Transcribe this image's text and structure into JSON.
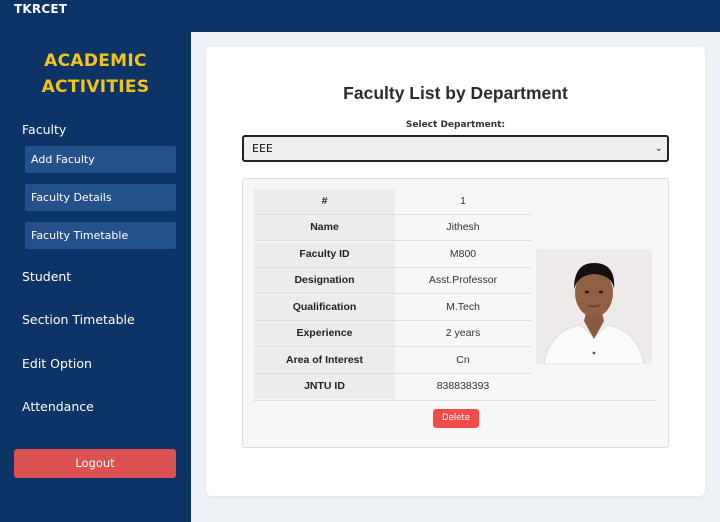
{
  "app": {
    "brand": "TKRCET"
  },
  "sidebar": {
    "title_line1": "ACADEMIC",
    "title_line2": "ACTIVITIES",
    "items": [
      {
        "label": "Faculty",
        "subitems": [
          "Add Faculty",
          "Faculty Details",
          "Faculty Timetable"
        ]
      },
      {
        "label": "Student"
      },
      {
        "label": "Section Timetable"
      },
      {
        "label": "Edit Option"
      },
      {
        "label": "Attendance"
      }
    ],
    "logout_label": "Logout"
  },
  "main": {
    "title": "Faculty List by Department",
    "select_label": "Select Department:",
    "selected_department": "EEE",
    "faculty": {
      "fields": [
        {
          "key": "#",
          "value": "1"
        },
        {
          "key": "Name",
          "value": "Jithesh"
        },
        {
          "key": "Faculty ID",
          "value": "M800"
        },
        {
          "key": "Designation",
          "value": "Asst.Professor"
        },
        {
          "key": "Qualification",
          "value": "M.Tech"
        },
        {
          "key": "Experience",
          "value": "2 years"
        },
        {
          "key": "Area of Interest",
          "value": "Cn"
        },
        {
          "key": "JNTU ID",
          "value": "838838393"
        }
      ],
      "delete_label": "Delete"
    }
  },
  "colors": {
    "navy": "#0c3466",
    "accent_yellow": "#f3c21b",
    "subitem_bg": "#24518a",
    "logout_red": "#db5050",
    "delete_red": "#f24b4b"
  }
}
